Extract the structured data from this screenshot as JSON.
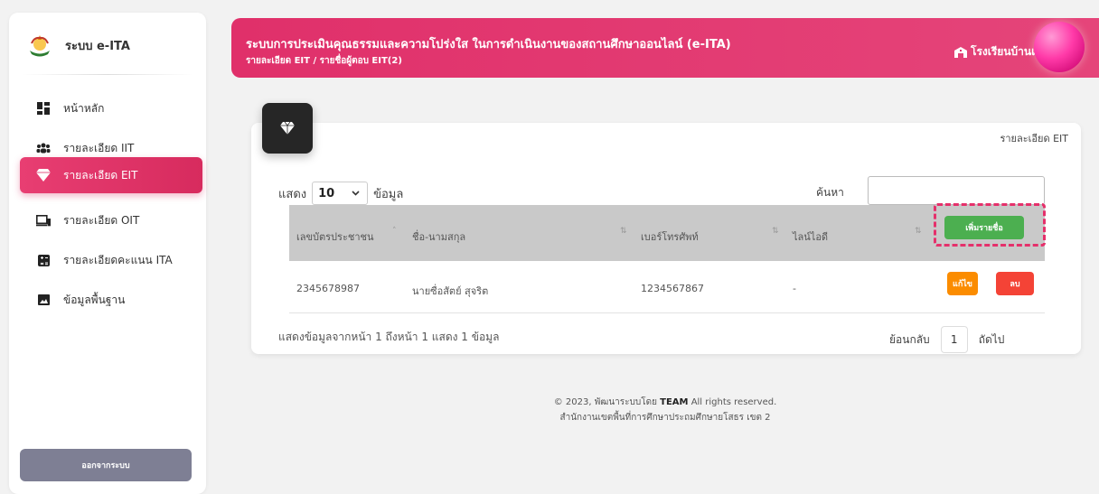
{
  "sidebar": {
    "brand": "ระบบ e-ITA",
    "items": [
      {
        "label": "หน้าหลัก",
        "icon": "dashboard-icon",
        "active": false
      },
      {
        "label": "รายละเอียด IIT",
        "icon": "users-icon",
        "active": false
      },
      {
        "label": "รายละเอียด EIT",
        "icon": "diamond-icon",
        "active": true
      },
      {
        "label": "รายละเอียด OIT",
        "icon": "devices-icon",
        "active": false
      },
      {
        "label": "รายละเอียดคะแนน ITA",
        "icon": "calculator-icon",
        "active": false
      },
      {
        "label": "ข้อมูลพื้นฐาน",
        "icon": "image-icon",
        "active": false
      }
    ],
    "logout": "ออกจากระบบ"
  },
  "header": {
    "title": "ระบบการประเมินคุณธรรมและความโปร่งใส ในการดำเนินงานของสถานศึกษาออนไลน์ (e-ITA)",
    "breadcrumb": "รายละเอียด EIT / รายชื่อผู้ตอบ EIT(2)",
    "school": "โรงเรียนบ้านเ"
  },
  "card": {
    "label": "รายละเอียด EIT",
    "length_prefix": "แสดง",
    "length_value": "10",
    "length_suffix": "ข้อมูล",
    "search_label": "ค้นหา",
    "search_value": "",
    "columns": [
      "เลขบัตรประชาชน",
      "ชื่อ-นามสกุล",
      "เบอร์โทรศัพท์",
      "ไลน์ไอดี"
    ],
    "add_button": "เพิ่มรายชื่อ",
    "rows": [
      {
        "id_card": "2345678987",
        "name": "นายซื่อสัตย์ สุจริต",
        "phone": "1234567867",
        "line_id": "-"
      }
    ],
    "edit_button": "แก้ไข",
    "delete_button": "ลบ",
    "info": "แสดงข้อมูลจากหน้า 1 ถึงหน้า 1 แสดง 1 ข้อมูล",
    "prev": "ย้อนกลับ",
    "page": "1",
    "next": "ถัดไป"
  },
  "footer": {
    "copyright_prefix": "© 2023, พัฒนาระบบโดย",
    "team": "TEAM",
    "rights": "All rights reserved.",
    "org": "สำนักงานเขตพื้นที่การศึกษาประถมศึกษายโสธร เขต 2"
  },
  "colors": {
    "accent": "#e0306a",
    "add_button": "#4caf50",
    "edit_button": "#fb8c00",
    "delete_button": "#f44336",
    "logout_button": "#7e7f94",
    "highlight": "#e5306b"
  }
}
